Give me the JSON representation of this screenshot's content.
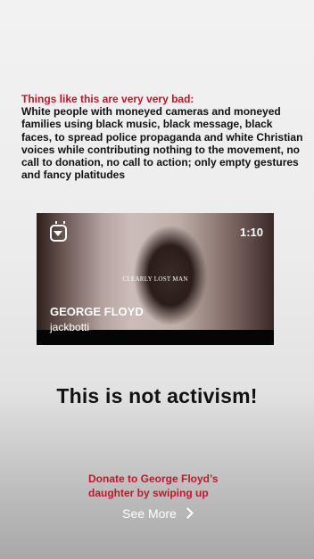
{
  "story": {
    "heading": "Things like this are very very bad:",
    "body": "White people with moneyed cameras and moneyed families using black music, black message, black faces, to spread police propaganda and white Christian voices while contributing nothing to the movement, no call to donation, no call to action; only empty gestures and fancy platitudes",
    "statement": "This is not activism!",
    "donate": "Donate to George Floyd’s daughter by swiping up"
  },
  "video": {
    "duration": "1:10",
    "caption": "CLEARLY LOST MAN",
    "title": "GEORGE FLOYD",
    "user": "jackbotti",
    "icon": "igtv-icon"
  },
  "cta": {
    "label": "See More",
    "icon": "chevron-right-icon"
  },
  "colors": {
    "accent": "#c0182a",
    "text": "#111111"
  }
}
